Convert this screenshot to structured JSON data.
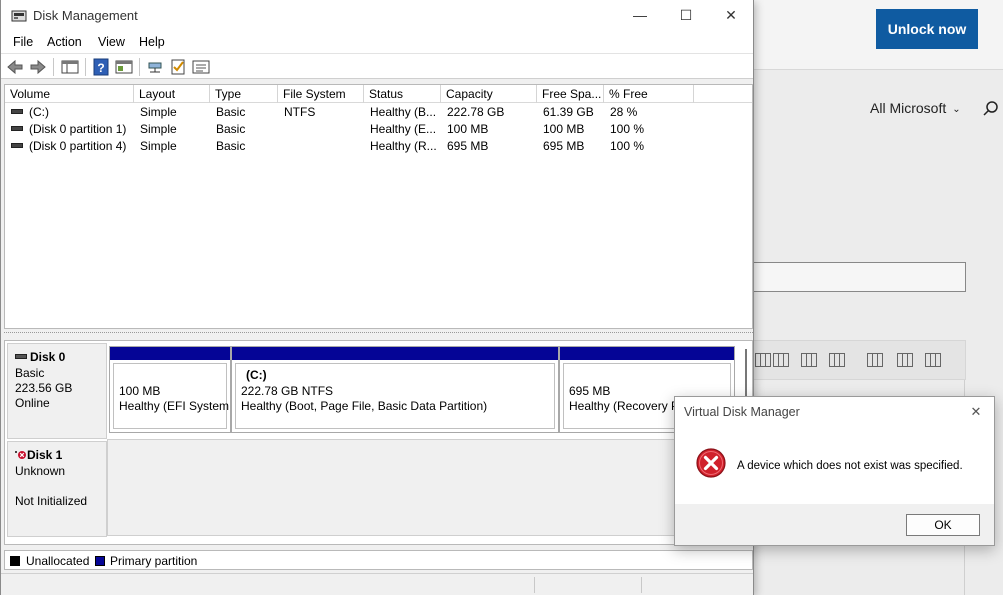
{
  "background_page": {
    "unlock_button": "Unlock now",
    "filter_label": "All Microsoft"
  },
  "window": {
    "title": "Disk Management",
    "controls": {
      "minimize": "—",
      "maximize": "☐",
      "close": "✕"
    }
  },
  "menu": [
    "File",
    "Action",
    "View",
    "Help"
  ],
  "toolbar_icons": [
    "back-icon",
    "forward-icon",
    "show-hide-tree-icon",
    "help-icon",
    "properties-icon",
    "connect-icon",
    "check-icon",
    "list-icon"
  ],
  "volume_list": {
    "columns": [
      "Volume",
      "Layout",
      "Type",
      "File System",
      "Status",
      "Capacity",
      "Free Spa...",
      "% Free"
    ],
    "rows": [
      [
        "(C:)",
        "Simple",
        "Basic",
        "NTFS",
        "Healthy (B...",
        "222.78 GB",
        "61.39 GB",
        "28 %"
      ],
      [
        "(Disk 0 partition 1)",
        "Simple",
        "Basic",
        "",
        "Healthy (E...",
        "100 MB",
        "100 MB",
        "100 %"
      ],
      [
        "(Disk 0 partition 4)",
        "Simple",
        "Basic",
        "",
        "Healthy (R...",
        "695 MB",
        "695 MB",
        "100 %"
      ]
    ]
  },
  "disks": [
    {
      "name": "Disk 0",
      "type": "Basic",
      "size": "223.56 GB",
      "status": "Online",
      "partitions": [
        {
          "label": "",
          "size": "100 MB",
          "status": "Healthy (EFI System"
        },
        {
          "label": "(C:)",
          "size": "222.78 GB NTFS",
          "status": "Healthy (Boot, Page File, Basic Data Partition)"
        },
        {
          "label": "",
          "size": "695 MB",
          "status": "Healthy (Recovery Pa"
        }
      ]
    },
    {
      "name": "Disk 1",
      "type": "Unknown",
      "status": "Not Initialized"
    }
  ],
  "legend": [
    {
      "label": "Unallocated",
      "color": "#000000"
    },
    {
      "label": "Primary partition",
      "color": "#050596"
    }
  ],
  "dialog": {
    "title": "Virtual Disk Manager",
    "message": "A device which does not exist was specified.",
    "ok_label": "OK",
    "close_glyph": "✕",
    "icon": "error-icon"
  }
}
